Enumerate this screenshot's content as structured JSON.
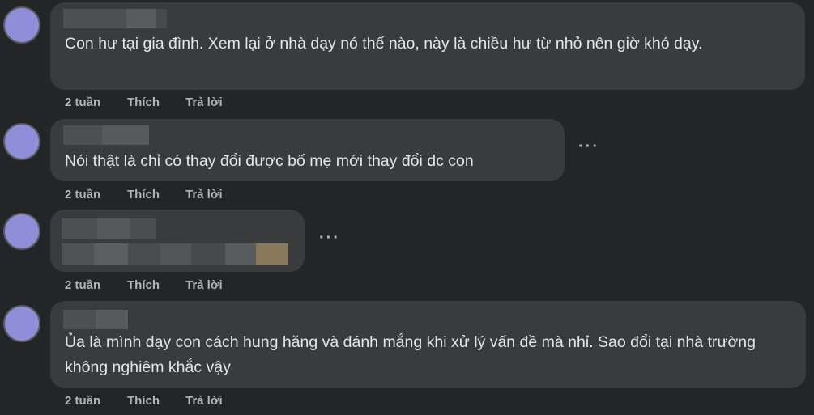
{
  "comments": [
    {
      "text": "Con hư tại gia đình. Xem lại ở nhà dạy nó thế nào, này là chiều hư từ nhỏ nên giờ khó dạy.",
      "time": "2 tuần",
      "like": "Thích",
      "reply": "Trả lời"
    },
    {
      "text": "Nói thật là chỉ có thay đổi được bố mẹ mới thay đổi dc con",
      "time": "2 tuần",
      "like": "Thích",
      "reply": "Trả lời",
      "more": "···"
    },
    {
      "text": "",
      "time": "2 tuần",
      "like": "Thích",
      "reply": "Trả lời",
      "more": "···"
    },
    {
      "text": "Ủa là mình dạy con cách hung hăng và đánh mắng khi xử lý vấn đề mà nhỉ. Sao đổi tại nhà trường không nghiêm khắc vậy",
      "time": "2 tuần",
      "like": "Thích",
      "reply": "Trả lời"
    }
  ],
  "colors": {
    "background": "#242526",
    "bubble": "#3a3b3c",
    "avatar": "#908ed8",
    "text": "#e4e6eb",
    "secondary_text": "#b0b3b8"
  }
}
